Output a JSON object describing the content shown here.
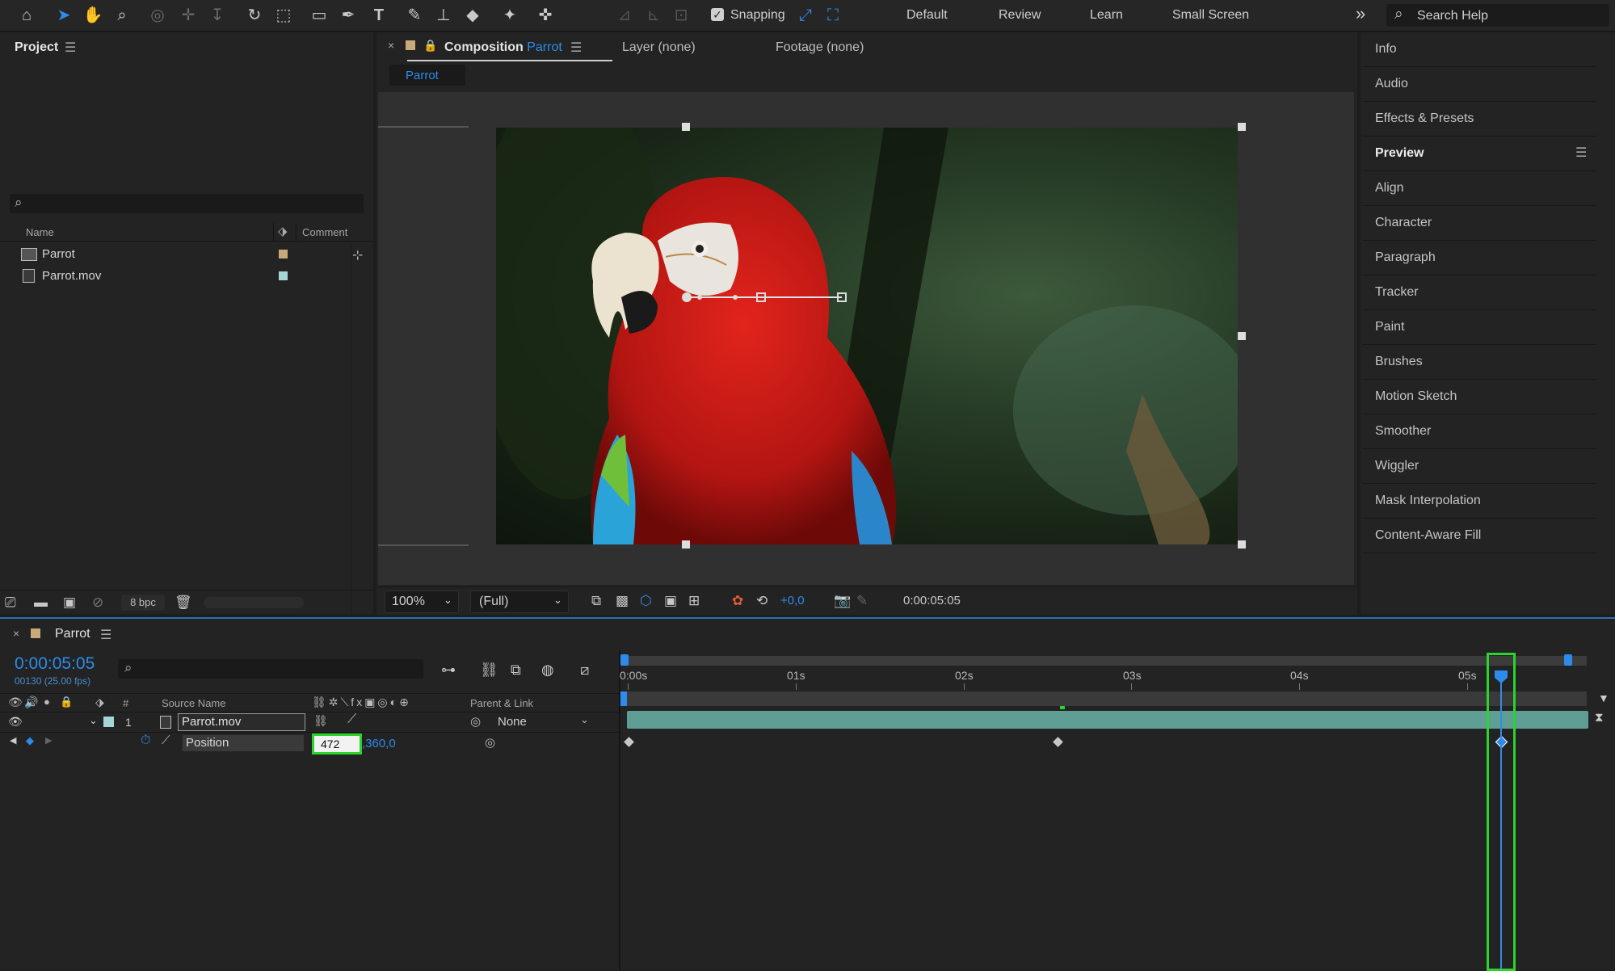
{
  "toolbar": {
    "snapping_label": "Snapping",
    "workspaces": [
      "Default",
      "Review",
      "Learn",
      "Small Screen"
    ],
    "overflow": "»",
    "search_placeholder": "Search Help"
  },
  "project": {
    "title": "Project",
    "columns": {
      "name": "Name",
      "comment": "Comment"
    },
    "items": [
      {
        "name": "Parrot",
        "type": "composition",
        "label_color": "#c8a979"
      },
      {
        "name": "Parrot.mov",
        "type": "footage",
        "label_color": "#a5d6d6"
      }
    ],
    "bpc": "8 bpc"
  },
  "comp_viewer": {
    "tabs": {
      "composition_prefix": "Composition",
      "composition_name": "Parrot",
      "layer": "Layer (none)",
      "footage": "Footage (none)"
    },
    "breadcrumb": "Parrot",
    "zoom": "100%",
    "resolution": "(Full)",
    "exposure": "+0,0",
    "timecode": "0:00:05:05"
  },
  "right_panel": {
    "items": [
      "Info",
      "Audio",
      "Effects & Presets",
      "Preview",
      "Align",
      "Character",
      "Paragraph",
      "Tracker",
      "Paint",
      "Brushes",
      "Motion Sketch",
      "Smoother",
      "Wiggler",
      "Mask Interpolation",
      "Content-Aware Fill"
    ],
    "active": "Preview"
  },
  "timeline": {
    "comp_name": "Parrot",
    "timecode": "0:00:05:05",
    "frame_info": "00130 (25.00 fps)",
    "columns": {
      "number": "#",
      "source_name": "Source Name",
      "parent": "Parent & Link"
    },
    "ruler": [
      "0:00s",
      "01s",
      "02s",
      "03s",
      "04s",
      "05s"
    ],
    "layer": {
      "index": "1",
      "name": "Parrot.mov",
      "parent": "None"
    },
    "property": {
      "name": "Position",
      "x_value": "472",
      "y_value": ",360,0"
    }
  },
  "colors": {
    "accent_blue": "#2d8ceb",
    "highlight_green": "#2bd42b",
    "layer_bar": "#5f9e95"
  }
}
